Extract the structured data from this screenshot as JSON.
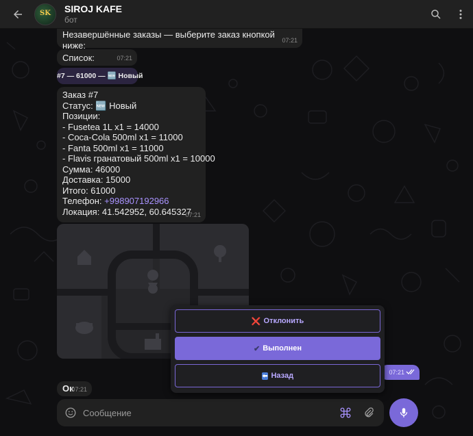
{
  "header": {
    "title": "SIROJ KAFE",
    "subtitle": "бот",
    "avatar_text": "SK"
  },
  "messages": {
    "intro": {
      "text": "Незавершённые заказы — выберите заказ кнопкой ниже:",
      "time": "07:21"
    },
    "list": {
      "text": "Список:",
      "time": "07:21"
    },
    "order_button": {
      "text": "#7 — 61000 — 🆕 Новый"
    },
    "order": {
      "lines": [
        "Заказ #7",
        "Статус: 🆕 Новый",
        "Позиции:",
        "- Fusetea 1L x1 = 14000",
        "- Coca-Cola 500ml x1 = 11000",
        "- Fanta 500ml x1 = 11000",
        "- Flavis гранатовый 500ml x1 = 10000",
        "Сумма: 46000",
        "Доставка: 15000",
        "Итого: 61000"
      ],
      "phone_label": "Телефон: ",
      "phone": "+998907192966",
      "location": "Локация: 41.542952, 60.645327",
      "time": "07:21"
    },
    "ok": {
      "text": "Ок",
      "time": "07:21"
    },
    "outgoing": {
      "time": "07:21"
    }
  },
  "keyboard": {
    "reject": {
      "icon": "❌",
      "label": "Отклонить"
    },
    "done": {
      "icon": "✔",
      "label": "Выполнен"
    },
    "back": {
      "icon": "⬅",
      "label": "Назад"
    }
  },
  "composer": {
    "placeholder": "Сообщение"
  },
  "colors": {
    "accent": "#7a69d9",
    "link": "#a993ff",
    "bubble": "#212121",
    "background": "#0f0f11"
  }
}
